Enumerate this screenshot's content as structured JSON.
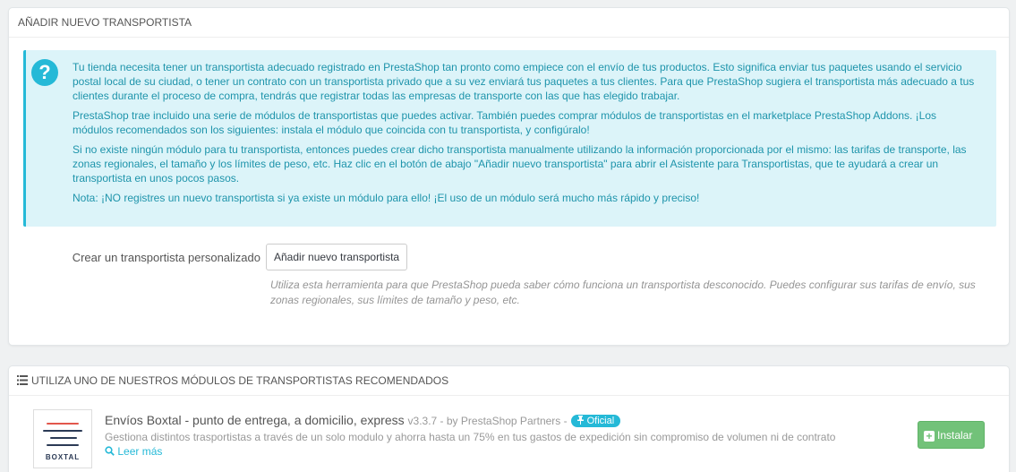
{
  "panel_add": {
    "title": "Añadir nuevo transportista",
    "alert": {
      "icon": "question-circle-icon",
      "paragraphs": [
        "Tu tienda necesita tener un transportista adecuado registrado en PrestaShop tan pronto como empiece con el envío de tus productos. Esto significa enviar tus paquetes usando el servicio postal local de su ciudad, o tener un contrato con un transportista privado que a su vez enviará tus paquetes a tus clientes. Para que PrestaShop sugiera el transportista más adecuado a tus clientes durante el proceso de compra, tendrás que registrar todas las empresas de transporte con las que has elegido trabajar.",
        "PrestaShop trae incluido una serie de módulos de transportistas que puedes activar. También puedes comprar módulos de transportistas en el marketplace PrestaShop Addons. ¡Los módulos recomendados son los siguientes: instala el módulo que coincida con tu transportista, y configúralo!",
        "Si no existe ningún módulo para tu transportista, entonces puedes crear dicho transportista manualmente utilizando la información proporcionada por el mismo: las tarifas de transporte, las zonas regionales, el tamaño y los límites de peso, etc. Haz clic en el botón de abajo \"Añadir nuevo transportista\" para abrir el Asistente para Transportistas, que te ayudará a crear un transportista en unos pocos pasos.",
        "Nota: ¡NO registres un nuevo transportista si ya existe un módulo para ello! ¡El uso de un módulo será mucho más rápido y preciso!"
      ]
    },
    "form_label": "Crear un transportista personalizado",
    "button_label": "Añadir nuevo transportista",
    "help_text": "Utiliza esta herramienta para que PrestaShop pueda saber cómo funciona un transportista desconocido. Puedes configurar sus tarifas de envío, sus zonas regionales, sus límites de tamaño y peso, etc."
  },
  "panel_modules": {
    "title": "Utiliza uno de nuestros módulos de transportistas recomendados",
    "title_icon": "list-icon",
    "module": {
      "name": "Envíos Boxtal - punto de entrega, a domicilio, express",
      "version": "v3.3.7 - by PrestaShop Partners -",
      "badge": "Oficial",
      "badge_icon": "pin-icon",
      "description": "Gestiona distintos trasportistas a través de un solo modulo y ahorra hasta un 75% en tus gastos de expedición sin compromiso de volumen ni de contrato",
      "read_more": "Leer más",
      "logo_text": "BOXTAL",
      "install_label": "Instalar"
    }
  },
  "colors": {
    "info_bg": "#dcf4f9",
    "info_text": "#1e94ab",
    "accent": "#25b9d7",
    "success": "#72c279"
  }
}
